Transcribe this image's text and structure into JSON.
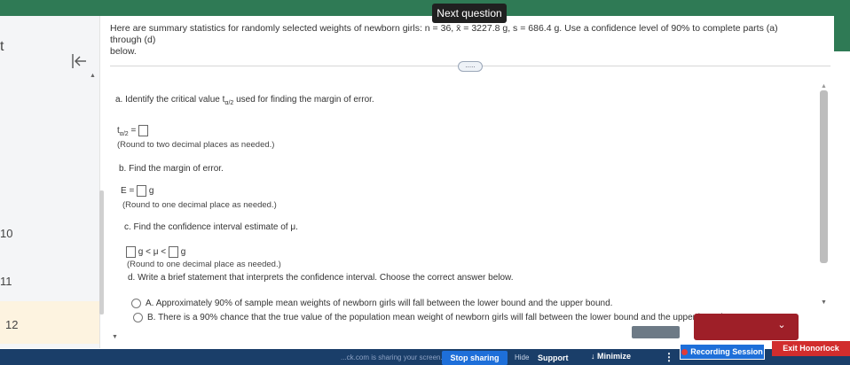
{
  "toolbar": {
    "next_question": "Next question"
  },
  "left_nav": {
    "items": [
      {
        "label": "t"
      },
      {
        "label": "10"
      },
      {
        "label": "11"
      },
      {
        "label": "12"
      }
    ]
  },
  "question": {
    "header_line1": "Here are summary statistics for randomly selected weights of newborn girls: n = 36, x̄ = 3227.8 g, s = 686.4 g. Use a confidence level of 90% to complete parts (a) through (d)",
    "header_line2": "below.",
    "more_label": "....."
  },
  "parts": {
    "a": {
      "title": "a. Identify the critical value t",
      "title_sub": "α/2",
      "title_tail": " used for finding the margin of error.",
      "eq_left": "t",
      "eq_sub": "α/2",
      "eq_right": " =",
      "hint": "(Round to two decimal places as needed.)"
    },
    "b": {
      "title": "b. Find the margin of error.",
      "eq_left": "E =",
      "unit": "g",
      "hint": "(Round to one decimal place as needed.)"
    },
    "c": {
      "title": "c. Find the confidence interval estimate of μ.",
      "middle": "g < μ <",
      "unit": "g",
      "hint": "(Round to one decimal place as needed.)"
    },
    "d": {
      "title": "d. Write a brief statement that interprets the confidence interval. Choose the correct answer below.",
      "options": [
        {
          "letter": "A.",
          "text": "Approximately 90% of sample mean weights of newborn girls will fall between the lower bound and the upper bound."
        },
        {
          "letter": "B.",
          "text": "There is a 90% chance that the true value of the population mean weight of newborn girls will fall between the lower bound and the upper bound."
        }
      ]
    }
  },
  "footer": {
    "screen_text": "...ck.com is sharing your screen.",
    "stop_sharing": "Stop sharing",
    "hide": "Hide",
    "support": "Support",
    "minimize": "Minimize",
    "recording": "Recording Session",
    "exit_honorlock": "Exit Honorlock"
  },
  "colors": {
    "accent_green": "#2f7a55",
    "stop_blue": "#1e6fd9",
    "exit_red": "#d12d2d",
    "footer_navy": "#1a3e69"
  }
}
